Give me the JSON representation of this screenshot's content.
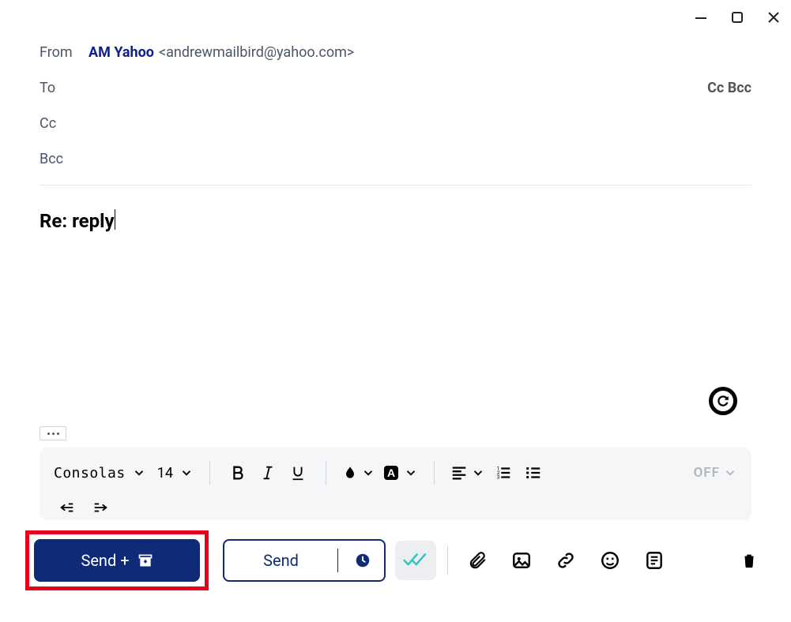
{
  "window": {
    "minimize_icon": "minimize-icon",
    "maximize_icon": "maximize-icon",
    "close_icon": "close-icon"
  },
  "from": {
    "label": "From",
    "name": "AM Yahoo",
    "email": "<andrewmailbird@yahoo.com>"
  },
  "to": {
    "label": "To"
  },
  "cc": {
    "label": "Cc"
  },
  "bcc": {
    "label": "Bcc"
  },
  "ccbcc_toggle": "Cc Bcc",
  "subject": "Re: reply",
  "toolbar": {
    "font_name": "Consolas",
    "font_size": "14",
    "off_label": "OFF"
  },
  "actions": {
    "send_primary": "Send  +",
    "send_secondary": "Send"
  }
}
